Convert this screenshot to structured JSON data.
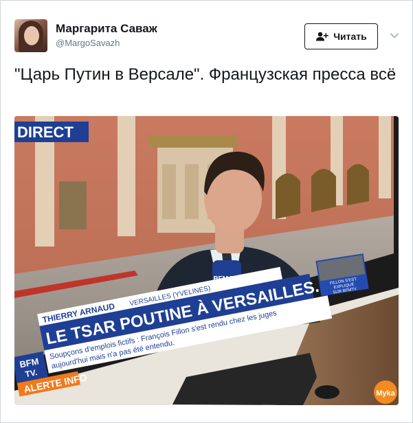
{
  "author": {
    "display_name": "Маргарита Саваж",
    "handle": "@MargoSavazh"
  },
  "follow_button": {
    "label": "Читать",
    "icon": "add-user-icon"
  },
  "menu_icon": "chevron-down-icon",
  "tweet": {
    "text": "\"Царь Путин в Версале\". Французская пресса всё"
  },
  "media": {
    "direct_label": "DIRECT",
    "mic_label": "BFM TV.",
    "reporter_name": "THIERRY ARNAUD",
    "location": "VERSAILLES (YVELINES)",
    "headline": "LE TSAR POUTINE À VERSAILLES.",
    "ticker_line_1": "Soupçons d'emplois fictifs : François Fillon s'est rendu chez les juges",
    "ticker_line_2": "aujourd'hui mais n'a pas été entendu.",
    "logo_top": "BFM",
    "logo_bottom": "TV.",
    "alert_label": "ALERTE INFO",
    "inset_line_1": "FILLON S'EST",
    "inset_line_2": "EXPLIQUÉ",
    "inset_line_3": "SUR BFMTV",
    "watermark": "Муkа"
  },
  "colors": {
    "text_primary": "#14171a",
    "text_secondary": "#657786",
    "bfm_blue": "#1f3f94",
    "alert_orange": "#f07a1c"
  }
}
